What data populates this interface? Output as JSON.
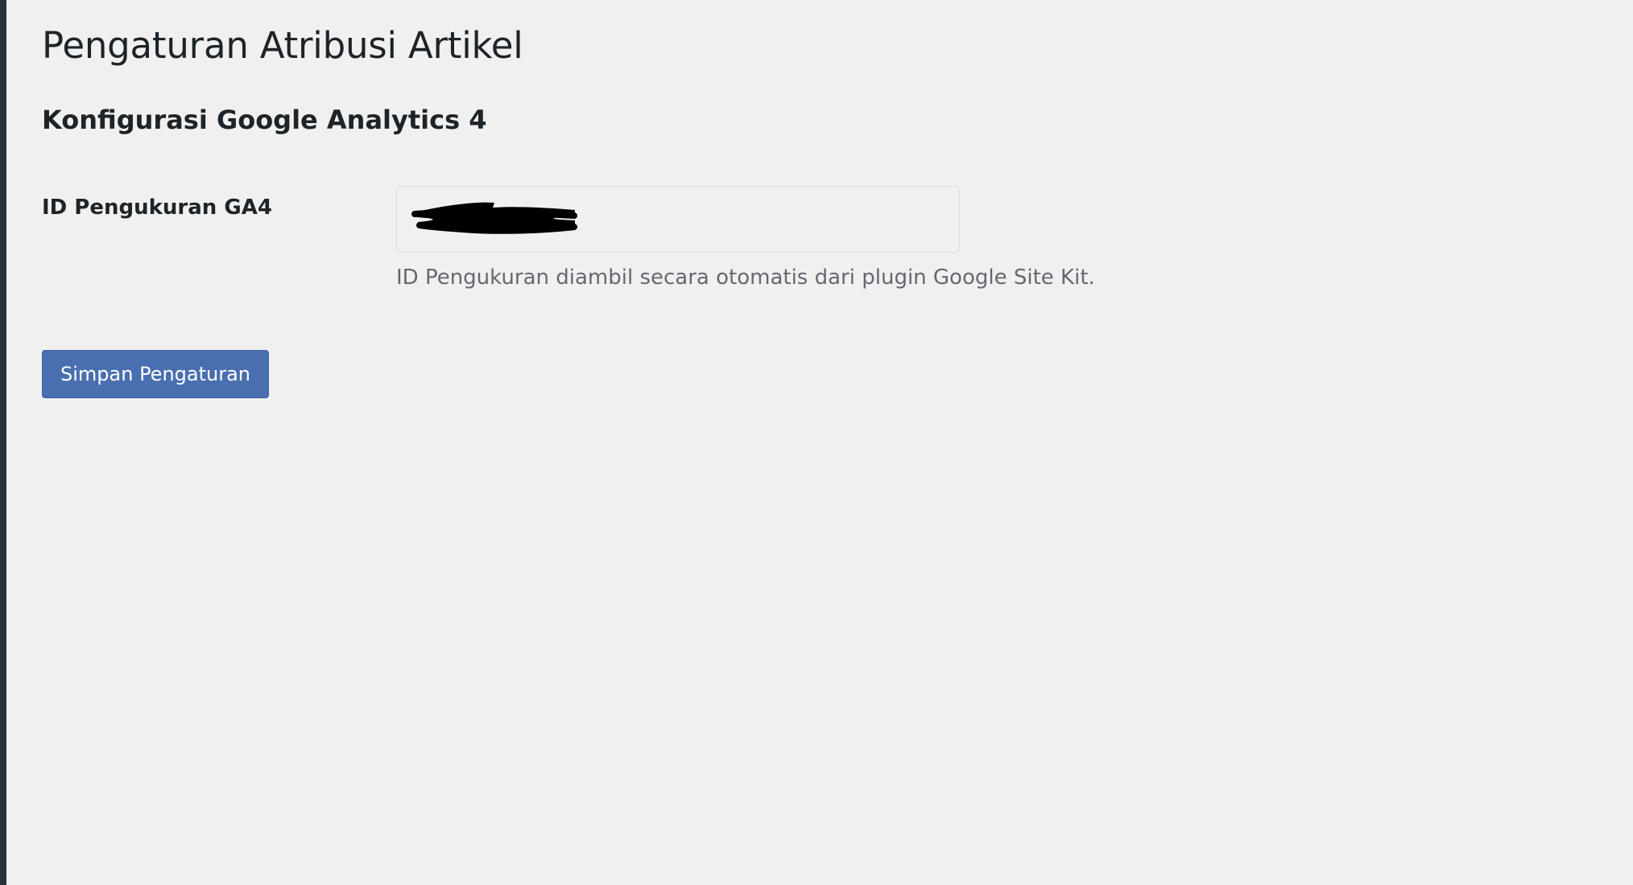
{
  "page": {
    "title": "Pengaturan Atribusi Artikel"
  },
  "section": {
    "title": "Konfigurasi Google Analytics 4"
  },
  "ga4_field": {
    "label": "ID Pengukuran GA4",
    "value": "",
    "description": "ID Pengukuran diambil secara otomatis dari plugin Google Site Kit."
  },
  "actions": {
    "save_label": "Simpan Pengaturan"
  },
  "colors": {
    "background": "#f0f0f1",
    "primary_button": "#4a6fb0",
    "text": "#1d2327",
    "muted_text": "#646970",
    "left_strip": "#2c3338"
  }
}
